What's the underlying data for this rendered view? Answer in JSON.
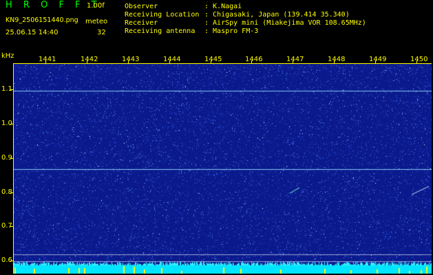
{
  "header": {
    "brand": "H R O F F T",
    "version": "1.00f",
    "filename": "KN9_2506151440.png",
    "meteo_label": "meteo",
    "datetime": "25.06.15 14:40",
    "count": "32"
  },
  "info": [
    {
      "label": "Observer",
      "value": ": K.Nagai"
    },
    {
      "label": "Receiving Location",
      "value": ": Chigasaki, Japan (139.414 35.340)"
    },
    {
      "label": "Receiver",
      "value": ": AirSpy mini (Miakejima VOR 108.65MHz)"
    },
    {
      "label": "Receiving antenna",
      "value": ": Maspro FM-3"
    }
  ],
  "axes": {
    "y_unit": "kHz",
    "x_ticks": [
      "1441",
      "1442",
      "1443",
      "1444",
      "1445",
      "1446",
      "1447",
      "1448",
      "1449",
      "1450"
    ],
    "y_ticks": [
      "1.1",
      "1.0",
      "0.9",
      "0.8",
      "0.7",
      "0.6"
    ]
  },
  "colors": {
    "background": "#000000",
    "label": "#ffff00",
    "brand": "#00ff00",
    "plot_base": "#0a1a8c",
    "noise": "#4e80ff",
    "carrier": "#9fe6ff",
    "strip": "#00e5ff"
  }
}
